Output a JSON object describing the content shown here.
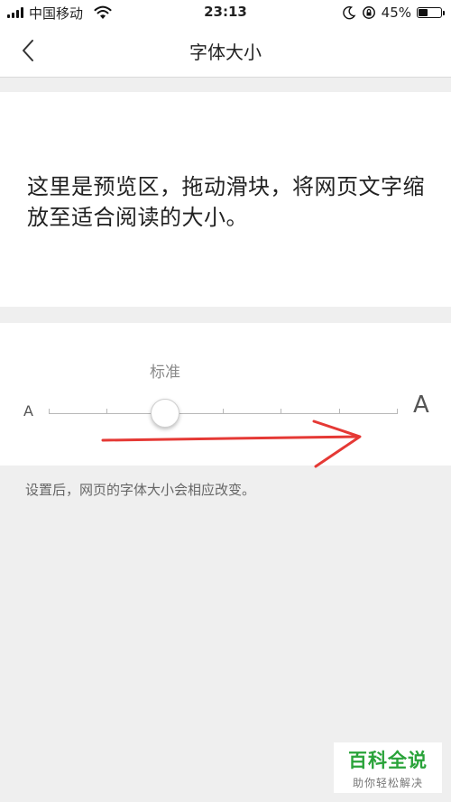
{
  "status_bar": {
    "carrier": "中国移动",
    "time": "23:13",
    "battery_percent": "45%",
    "battery_level": 0.45,
    "icons": [
      "signal-icon",
      "wifi-icon",
      "moon-icon",
      "rotation-lock-icon",
      "battery-icon"
    ]
  },
  "nav": {
    "back_icon": "chevron-left-icon",
    "title": "字体大小"
  },
  "preview": {
    "text": "这里是预览区，拖动滑块，将网页文字缩放至适合阅读的大小。"
  },
  "font_slider": {
    "current_label": "标准",
    "min_label": "A",
    "max_label": "A",
    "steps": 7,
    "selected_index": 2
  },
  "annotation": {
    "type": "red-arrow",
    "color": "#e53935"
  },
  "note": "设置后，网页的字体大小会相应改变。",
  "watermark": {
    "title": "百科全说",
    "subtitle": "助你轻松解决"
  }
}
